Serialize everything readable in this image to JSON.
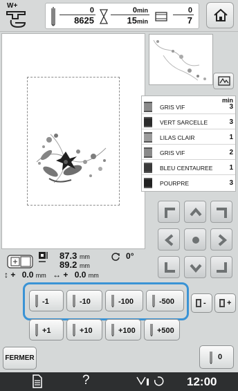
{
  "topbar": {
    "presser_foot_label": "W+",
    "stitch_count": "0",
    "stitch_total": "8625",
    "time_elapsed": "0",
    "time_elapsed_unit": "min",
    "time_total": "15",
    "time_total_unit": "min",
    "color_current": "0",
    "color_total": "7"
  },
  "threads": {
    "header": "min",
    "items": [
      {
        "name": "GRIS VIF",
        "minutes": "3",
        "color": "#8a8a8a"
      },
      {
        "name": "VERT SARCELLE",
        "minutes": "3",
        "color": "#2b2b2b"
      },
      {
        "name": "LILAS CLAIR",
        "minutes": "1",
        "color": "#9b9b9b"
      },
      {
        "name": "GRIS VIF",
        "minutes": "2",
        "color": "#8a8a8a"
      },
      {
        "name": "BLEU CENTAUREE",
        "minutes": "1",
        "color": "#3a3a3a"
      },
      {
        "name": "POURPRE",
        "minutes": "3",
        "color": "#222222"
      }
    ]
  },
  "info": {
    "width_value": "87.3",
    "height_value": "89.2",
    "size_unit": "mm",
    "angle_value": "0",
    "angle_unit": "°",
    "offset_v": "0.0",
    "offset_h": "0.0",
    "offset_unit": "mm"
  },
  "buttons": {
    "minus_1": "-1",
    "minus_10": "-10",
    "minus_100": "-100",
    "minus_500": "-500",
    "plus_1": "+1",
    "plus_10": "+10",
    "plus_100": "+100",
    "plus_500": "+500",
    "color_prev": "-",
    "color_next": "+",
    "fermer": "FERMER",
    "reset": "0"
  },
  "status": {
    "time": "12:00",
    "help": "?"
  },
  "colors": {
    "highlight": "#3a93d5",
    "status_bar": "#2d2f30"
  }
}
